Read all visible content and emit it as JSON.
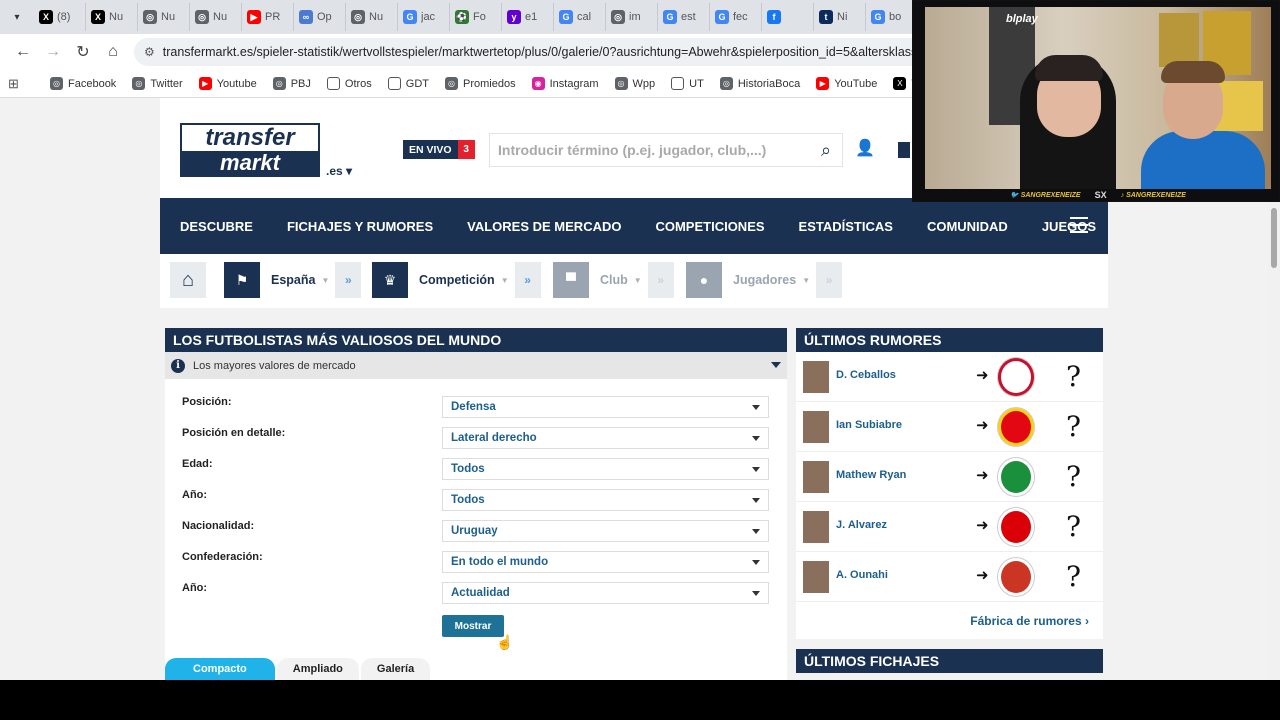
{
  "browser": {
    "tabs": [
      {
        "label": "(8)",
        "icon": "x-icon",
        "color": "#000000",
        "glyph": "X"
      },
      {
        "label": "Nu",
        "icon": "x-icon",
        "color": "#000000",
        "glyph": "X"
      },
      {
        "label": "Nu",
        "icon": "globe-icon",
        "color": "#5f6368",
        "glyph": "◎"
      },
      {
        "label": "Nu",
        "icon": "globe-icon",
        "color": "#5f6368",
        "glyph": "◎"
      },
      {
        "label": "PR",
        "icon": "youtube-icon",
        "color": "#ff0000",
        "glyph": "▶"
      },
      {
        "label": "Op",
        "icon": "link-icon",
        "color": "#4a7bd0",
        "glyph": "∞"
      },
      {
        "label": "Nu",
        "icon": "globe-icon",
        "color": "#5f6368",
        "glyph": "◎"
      },
      {
        "label": "jac",
        "icon": "google-icon",
        "color": "#4285f4",
        "glyph": "G"
      },
      {
        "label": "Fo",
        "icon": "football-icon",
        "color": "#2d7a2d",
        "glyph": "⚽"
      },
      {
        "label": "e1",
        "icon": "yahoo-icon",
        "color": "#6001d2",
        "glyph": "y"
      },
      {
        "label": "cal",
        "icon": "google-icon",
        "color": "#4285f4",
        "glyph": "G"
      },
      {
        "label": "im",
        "icon": "globe-icon",
        "color": "#5f6368",
        "glyph": "◎"
      },
      {
        "label": "est",
        "icon": "google-icon",
        "color": "#4285f4",
        "glyph": "G"
      },
      {
        "label": "fec",
        "icon": "google-icon",
        "color": "#4285f4",
        "glyph": "G"
      },
      {
        "label": "",
        "icon": "facebook-icon",
        "color": "#1877f2",
        "glyph": "f"
      },
      {
        "label": "Ni",
        "icon": "tyc-icon",
        "color": "#0c2a5a",
        "glyph": "t"
      },
      {
        "label": "bo",
        "icon": "google-icon",
        "color": "#4285f4",
        "glyph": "G"
      }
    ],
    "url": "transfermarkt.es/spieler-statistik/wertvollstespieler/marktwertetop/plus/0/galerie/0?ausrichtung=Abwehr&spielerposition_id=5&altersklasse=alle&",
    "bookmarks": [
      {
        "label": "Facebook",
        "icon": "globe-icon",
        "color": "#5f6368",
        "glyph": "◎"
      },
      {
        "label": "Twitter",
        "icon": "globe-icon",
        "color": "#5f6368",
        "glyph": "◎"
      },
      {
        "label": "Youtube",
        "icon": "youtube-icon",
        "color": "#ff0000",
        "glyph": "▶"
      },
      {
        "label": "PBJ",
        "icon": "globe-icon",
        "color": "#5f6368",
        "glyph": "◎"
      },
      {
        "label": "Otros",
        "icon": "folder-icon",
        "color": "#ffffff",
        "glyph": "▭"
      },
      {
        "label": "GDT",
        "icon": "folder-icon",
        "color": "#ffffff",
        "glyph": "▭"
      },
      {
        "label": "Promiedos",
        "icon": "globe-icon",
        "color": "#5f6368",
        "glyph": "◎"
      },
      {
        "label": "Instagram",
        "icon": "instagram-icon",
        "color": "#d6249f",
        "glyph": "◉"
      },
      {
        "label": "Wpp",
        "icon": "globe-icon",
        "color": "#5f6368",
        "glyph": "◎"
      },
      {
        "label": "UT",
        "icon": "folder-icon",
        "color": "#ffffff",
        "glyph": "▭"
      },
      {
        "label": "HistoriaBoca",
        "icon": "globe-icon",
        "color": "#5f6368",
        "glyph": "◎"
      },
      {
        "label": "YouTube",
        "icon": "youtube-icon",
        "color": "#ff0000",
        "glyph": "▶"
      },
      {
        "label": "Twitter",
        "icon": "x-icon",
        "color": "#000000",
        "glyph": "X"
      }
    ]
  },
  "site": {
    "logo_top": "transfer",
    "logo_bottom": "markt",
    "tld": ".es",
    "live_label": "EN VIVO",
    "live_count": "3",
    "search_placeholder": "Introducir término (p.ej. jugador, club,...)",
    "nav": [
      "DESCUBRE",
      "FICHAJES Y RUMORES",
      "VALORES DE MERCADO",
      "COMPETICIONES",
      "ESTADÍSTICAS",
      "COMUNIDAD",
      "JUEGOS"
    ],
    "breadcrumb": [
      {
        "label": "España",
        "icon": "flag-icon",
        "glyph": "⚑",
        "dim": false
      },
      {
        "label": "Competición",
        "icon": "trophy-icon",
        "glyph": "♛",
        "dim": false
      },
      {
        "label": "Club",
        "icon": "shirt-icon",
        "glyph": "▀",
        "dim": true
      },
      {
        "label": "Jugadores",
        "icon": "player-icon",
        "glyph": "●",
        "dim": true
      }
    ]
  },
  "main": {
    "title": "LOS FUTBOLISTAS MÁS VALIOSOS DEL MUNDO",
    "subtitle": "Los mayores valores de mercado",
    "filters": [
      {
        "label": "Posición:",
        "value": "Defensa"
      },
      {
        "label": "Posición en detalle:",
        "value": "Lateral derecho"
      },
      {
        "label": "Edad:",
        "value": "Todos"
      },
      {
        "label": "Año:",
        "value": "Todos"
      },
      {
        "label": "Nacionalidad:",
        "value": "Uruguay"
      },
      {
        "label": "Confederación:",
        "value": "En todo el mundo"
      },
      {
        "label": "Año:",
        "value": "Actualidad"
      }
    ],
    "submit_label": "Mostrar",
    "view_tabs": [
      "Compacto",
      "Ampliado",
      "Galería"
    ]
  },
  "sidebar": {
    "rumors_title": "ÚLTIMOS RUMORES",
    "rumors": [
      {
        "name": "D. Ceballos",
        "crest_color": "#ffffff",
        "crest_accent": "#c8102e",
        "q": "?"
      },
      {
        "name": "Ian Subiabre",
        "crest_color": "#e30613",
        "crest_accent": "#fcd116",
        "q": "?"
      },
      {
        "name": "Mathew Ryan",
        "crest_color": "#1a8f3c",
        "crest_accent": "#ffffff",
        "q": "?"
      },
      {
        "name": "J. Alvarez",
        "crest_color": "#db0007",
        "crest_accent": "#ffffff",
        "q": "?"
      },
      {
        "name": "A. Ounahi",
        "crest_color": "#cb3524",
        "crest_accent": "#ffffff",
        "q": "?"
      }
    ],
    "rumors_link": "Fábrica de rumores",
    "transfers_title": "ÚLTIMOS FICHAJES"
  },
  "webcam": {
    "logo": "blplay",
    "handles": [
      "SANGREXENEIZE",
      "SANGREXENEIZE"
    ],
    "center_glyph": "SX"
  },
  "colors": {
    "brand_navy": "#1a3151",
    "link_blue": "#1d5f8c",
    "button_teal": "#1e7298",
    "active_tab": "#1fb3e9",
    "live_red": "#e3202b"
  }
}
